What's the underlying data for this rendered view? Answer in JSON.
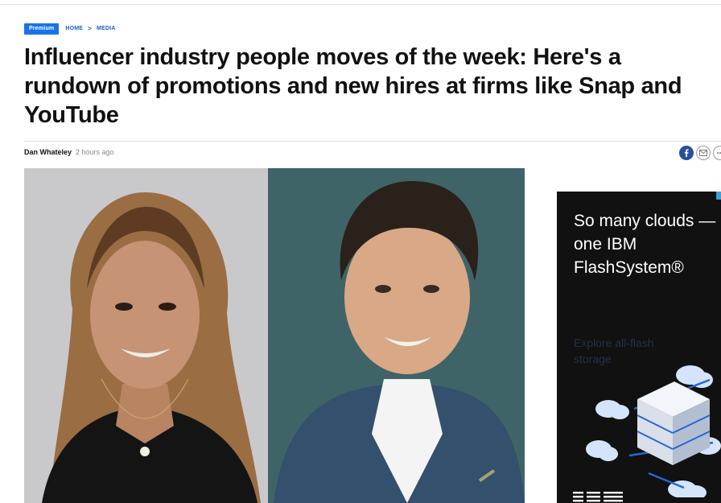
{
  "breadcrumb": {
    "badge": "Premium",
    "home": "HOME",
    "separator": ">",
    "section": "MEDIA"
  },
  "article": {
    "headline": "Influencer industry people moves of the week: Here's a rundown of promotions and new hires at firms like Snap and YouTube",
    "author": "Dan Whateley",
    "time": "2 hours ago"
  },
  "share": {
    "icons": [
      "facebook-icon",
      "email-icon",
      "more-icon"
    ]
  },
  "ad": {
    "headline": "So many clouds — one IBM FlashSystem®",
    "cta": "Explore all-flash storage",
    "logo": "IBM"
  },
  "colors": {
    "premium_badge": "#1a73e8",
    "breadcrumb_link": "#1b5fc1",
    "facebook": "#2a4f9a",
    "ad_background": "#111111",
    "ad_cta": "#22304b"
  }
}
